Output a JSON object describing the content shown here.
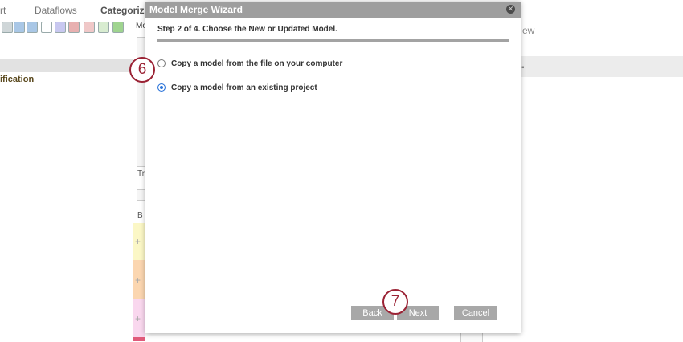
{
  "app": {
    "tabs": [
      {
        "label": "rt"
      },
      {
        "label": "Dataflows"
      },
      {
        "label": "Categorize"
      }
    ],
    "toolbar_truncated_label": "Mo",
    "left_panel_heading": "ification",
    "right_panel_text": "ew",
    "side_fragments": [
      "Tr",
      "B"
    ]
  },
  "dialog": {
    "title": "Model Merge Wizard",
    "close_icon": "close-circle-icon",
    "step_text": "Step 2 of 4. Choose the New or Updated Model.",
    "options": [
      {
        "label": "Copy a model from the file on your computer",
        "selected": false
      },
      {
        "label": "Copy a model from an existing project",
        "selected": true
      }
    ],
    "buttons": {
      "back": "Back",
      "next": "Next",
      "cancel": "Cancel"
    }
  },
  "callouts": [
    {
      "label": "6"
    },
    {
      "label": "7"
    }
  ],
  "colors": {
    "title_bar": "#9e9e9e",
    "callout": "#9b2335",
    "radio_selected": "#2a73d9",
    "button": "#a8a8a8"
  }
}
